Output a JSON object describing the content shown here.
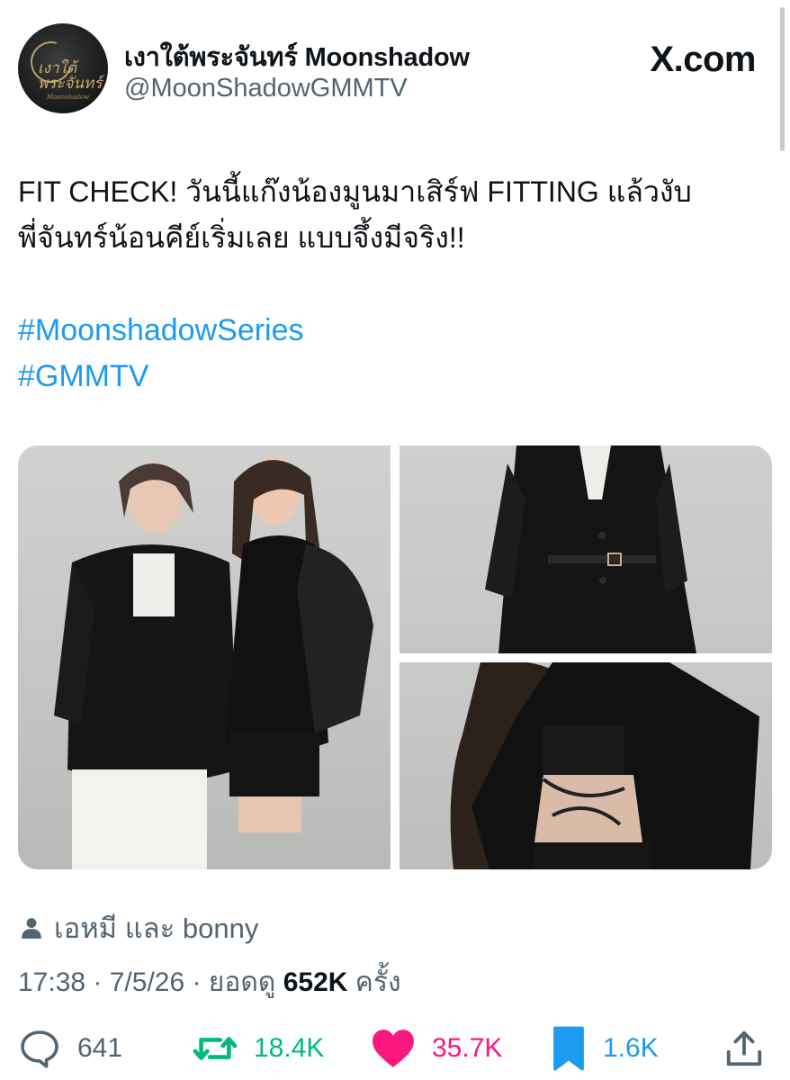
{
  "header": {
    "display_name": "เงาใต้พระจันทร์ Moonshadow",
    "handle": "@MoonShadowGMMTV",
    "brand": "X.com",
    "avatar_logo_text": "เงาใต้พระจันทร์",
    "avatar_logo_subtext": "Moonshadow"
  },
  "tweet": {
    "line1": "FIT CHECK! วันนี้แก๊งน้องมูนมาเสิร์ฟ FITTING แล้วงับ",
    "line2": "พี่จันทร์น้อนคีย์เริ่มเลย แบบจึ้งมีจริง!!",
    "hashtags": [
      "#MoonshadowSeries",
      "#GMMTV"
    ]
  },
  "media": {
    "photo_count": 3
  },
  "meta": {
    "tagged": "เอหมี และ bonny",
    "time_date": "17:38 · 7/5/26 · ยอดดู ",
    "views": "652K",
    "views_suffix": " ครั้ง"
  },
  "actions": {
    "replies": "641",
    "reposts": "18.4K",
    "likes": "35.7K",
    "bookmarks": "1.6K"
  },
  "colors": {
    "accent": "#1d9bf0",
    "repost": "#00ba7c",
    "like": "#f91880",
    "secondary_text": "#536471"
  }
}
